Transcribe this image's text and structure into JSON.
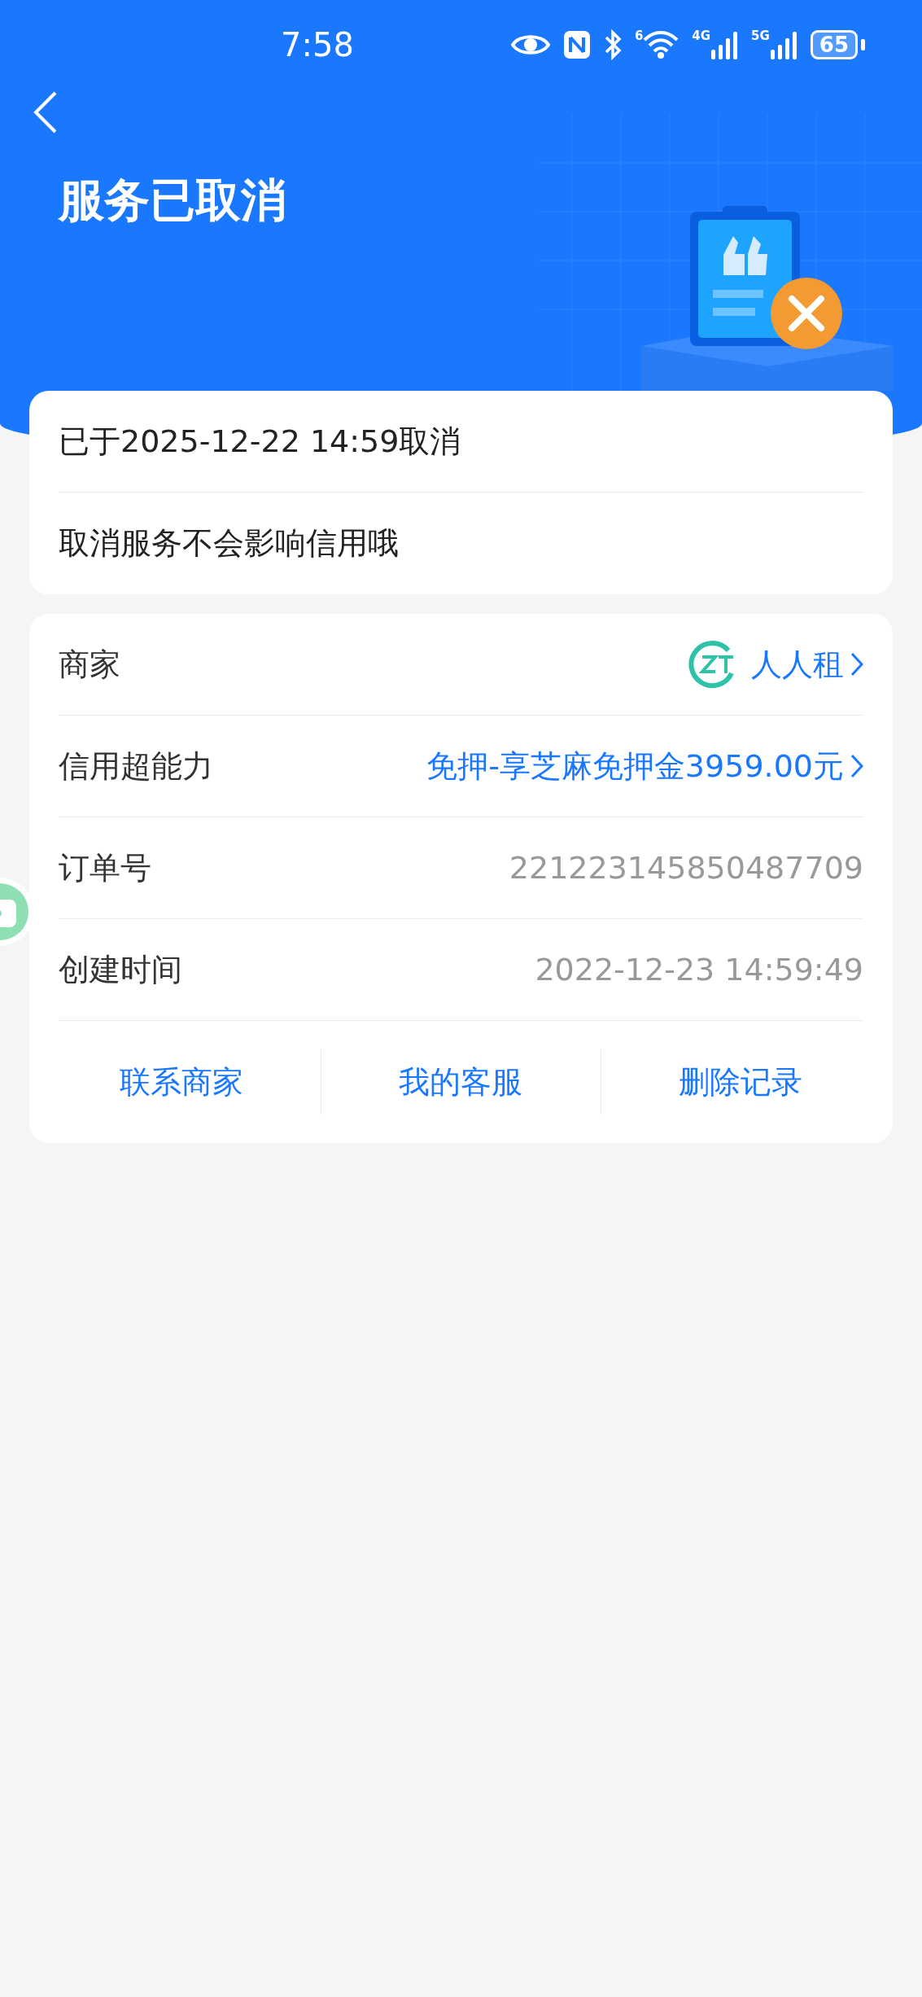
{
  "status_bar": {
    "time": "7:58",
    "wifi_label": "6",
    "signal_labels": [
      "4G",
      "5G"
    ],
    "battery": "65"
  },
  "header": {
    "title": "服务已取消"
  },
  "notice": {
    "lines": [
      "已于2025-12-22 14:59取消",
      "取消服务不会影响信用哦"
    ]
  },
  "details": {
    "rows": [
      {
        "kind": "merchant",
        "label": "商家",
        "value": "人人租"
      },
      {
        "kind": "link",
        "label": "信用超能力",
        "value": "免押-享芝麻免押金3959.00元"
      },
      {
        "kind": "plain",
        "label": "订单号",
        "value": "221223145850487709"
      },
      {
        "kind": "plain",
        "label": "创建时间",
        "value": "2022-12-23 14:59:49"
      }
    ],
    "actions": [
      "联系商家",
      "我的客服",
      "删除记录"
    ]
  }
}
